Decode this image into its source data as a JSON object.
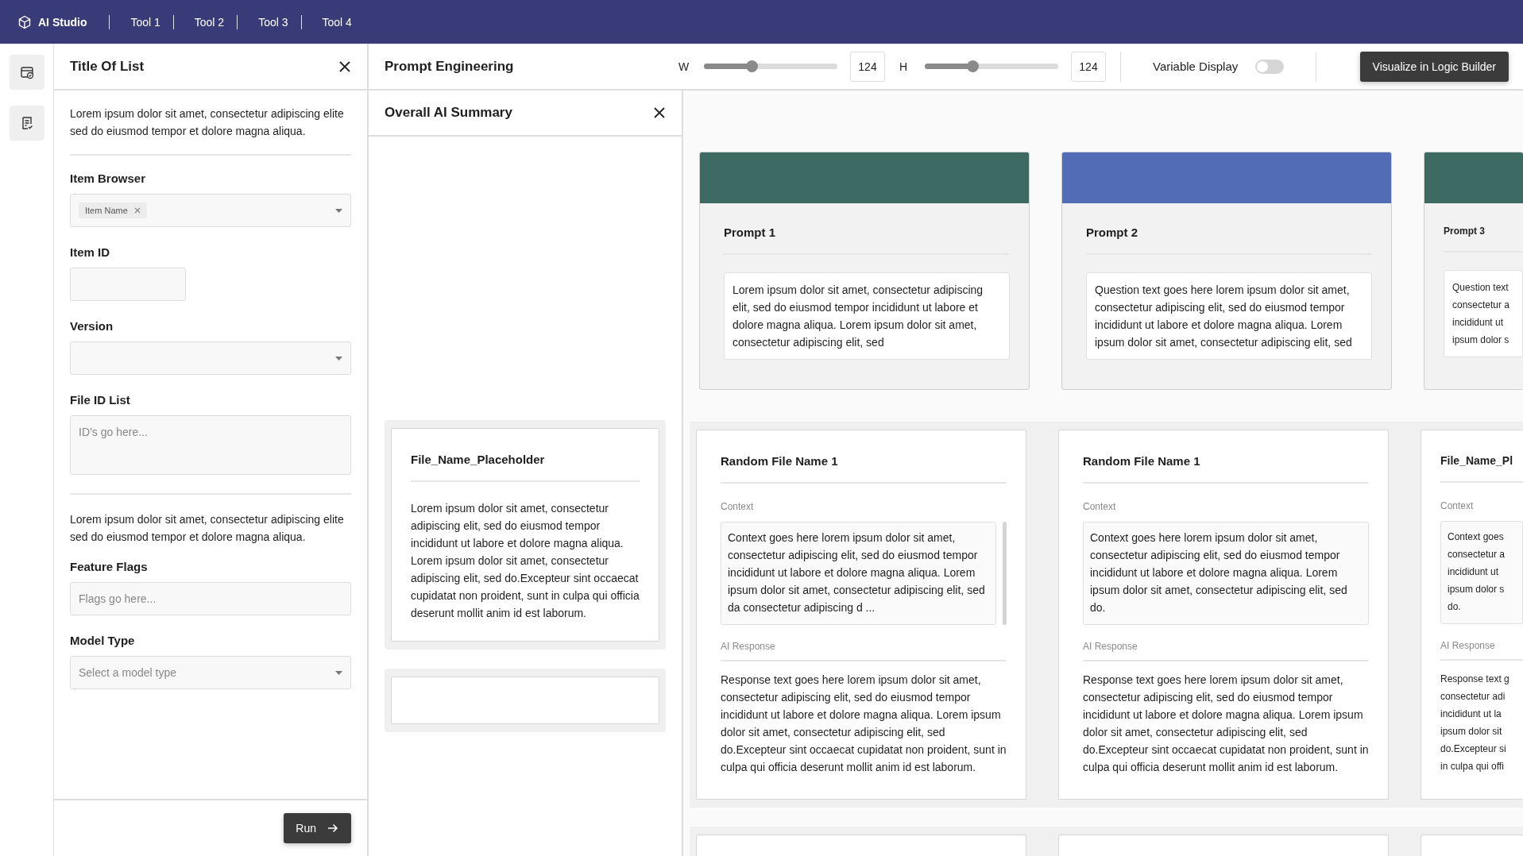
{
  "topbar": {
    "brand": "AI Studio",
    "tools": [
      "Tool 1",
      "Tool 2",
      "Tool 3",
      "Tool 4"
    ]
  },
  "left_panel": {
    "title": "Title Of List",
    "sections": [
      {
        "description": "Lorem ipsum dolor sit amet, consectetur adipiscing elite sed do eiusmod tempor et dolore magna aliqua.",
        "fields": [
          {
            "kind": "chips",
            "label": "Item Browser",
            "chips": [
              "Item Name"
            ]
          },
          {
            "kind": "short-input",
            "label": "Item ID"
          },
          {
            "kind": "select",
            "label": "Version"
          },
          {
            "kind": "textarea",
            "label": "File ID List",
            "placeholder": "ID’s go here..."
          }
        ]
      },
      {
        "description": "Lorem ipsum dolor sit amet, consectetur adipiscing elite sed do eiusmod tempor et dolore magna aliqua.",
        "fields": [
          {
            "kind": "input",
            "label": "Feature Flags",
            "placeholder": "Flags go here..."
          },
          {
            "kind": "select",
            "label": "Model Type",
            "placeholder": "Select a model type"
          }
        ]
      }
    ],
    "run_button": "Run"
  },
  "toolbar": {
    "title": "Prompt Engineering",
    "sliders": [
      {
        "label": "W",
        "level": 0.36,
        "value": "124"
      },
      {
        "label": "H",
        "level": 0.36,
        "value": "124"
      }
    ],
    "toggle": {
      "label": "Variable Display",
      "on": false
    },
    "action": "Visualize in Logic Builder"
  },
  "summary_panel": {
    "title": "Overall AI Summary",
    "file_card": {
      "title": "File_Name_Placeholder",
      "text": "Lorem ipsum dolor sit amet, consectetur adipiscing elit, sed do eiusmod tempor incididunt ut labore et dolore magna aliqua. Lorem ipsum dolor sit amet, consectetur adipiscing elit, sed do.Excepteur sint occaecat cupidatat non proident, sunt in culpa qui officia deserunt mollit anim id est laborum."
    }
  },
  "prompts": [
    {
      "title": "Prompt 1",
      "color": "#3d6b63",
      "text": "Lorem ipsum dolor sit amet, consectetur adipiscing elit, sed do eiusmod tempor incididunt ut labore et dolore magna aliqua. Lorem ipsum dolor sit amet, consectetur adipiscing elit, sed"
    },
    {
      "title": "Prompt 2",
      "color": "#526db5",
      "text": "Question text goes here lorem ipsum dolor sit amet, consectetur adipiscing elit, sed do eiusmod tempor incididunt ut labore et dolore magna aliqua. Lorem ipsum dolor sit amet, consectetur adipiscing elit, sed"
    },
    {
      "title": "Prompt 3",
      "color": "#3d6b63",
      "text": "Question text\nconsectetur a\nincididunt ut\nipsum dolor s"
    }
  ],
  "files": [
    {
      "title": "Random File Name 1",
      "context_label": "Context",
      "context": "Context goes here lorem ipsum dolor sit amet, consectetur adipiscing elit, sed do eiusmod tempor incididunt ut labore et dolore magna aliqua. Lorem ipsum dolor sit amet, consectetur adipiscing elit, sed da consectetur adipiscing d ...",
      "scrollable": true,
      "response_label": "AI Response",
      "response": "Response text goes here lorem ipsum dolor sit amet, consectetur adipiscing elit, sed do eiusmod tempor incididunt ut labore et dolore magna aliqua. Lorem ipsum dolor sit amet, consectetur adipiscing elit, sed do.Excepteur sint occaecat cupidatat non proident, sunt in culpa qui officia deserunt mollit anim id est laborum."
    },
    {
      "title": "Random File Name 1",
      "context_label": "Context",
      "context": "Context goes here lorem ipsum dolor sit amet, consectetur adipiscing elit, sed do eiusmod tempor incididunt ut labore et dolore magna aliqua. Lorem ipsum dolor sit amet, consectetur adipiscing elit, sed do.",
      "scrollable": false,
      "response_label": "AI Response",
      "response": "Response text goes here lorem ipsum dolor sit amet, consectetur adipiscing elit, sed do eiusmod tempor incididunt ut labore et dolore magna aliqua. Lorem ipsum dolor sit amet, consectetur adipiscing elit, sed do.Excepteur sint occaecat cupidatat non proident, sunt in culpa qui officia deserunt mollit anim id est laborum."
    },
    {
      "title": "File_Name_Pl",
      "context_label": "Context",
      "context": "Context goes\nconsectetur a\nincididunt ut\nipsum dolor s\ndo.",
      "scrollable": false,
      "response_label": "AI Response",
      "response": "Response text g\nconsectetur adi\nincididunt ut la\nipsum dolor sit\ndo.Excepteur si\nin culpa qui offi"
    }
  ]
}
